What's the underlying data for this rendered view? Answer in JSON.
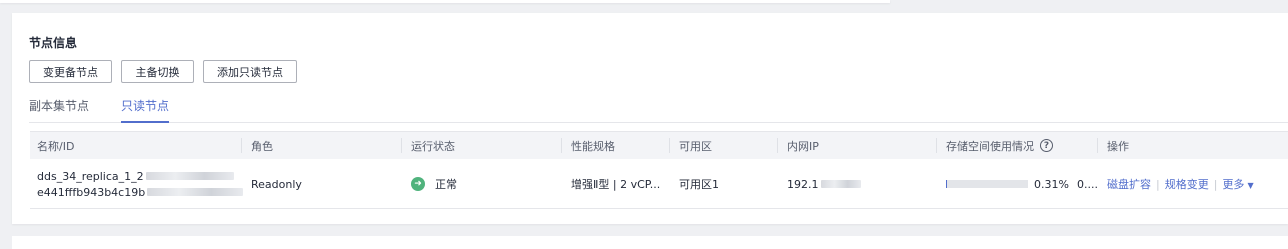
{
  "section": {
    "title": "节点信息"
  },
  "buttons": {
    "change_standby": "变更备节点",
    "switch_primary": "主备切换",
    "add_readonly": "添加只读节点"
  },
  "tabs": [
    {
      "label": "副本集节点",
      "active": false
    },
    {
      "label": "只读节点",
      "active": true
    }
  ],
  "table": {
    "headers": {
      "name": "名称/ID",
      "role": "角色",
      "status": "运行状态",
      "spec": "性能规格",
      "az": "可用区",
      "ip": "内网IP",
      "storage": "存储空间使用情况",
      "actions": "操作"
    },
    "rows": [
      {
        "name": "dds_34_replica_1_2",
        "id": "e441fffb943b4c19b",
        "role": "Readonly",
        "status": "正常",
        "spec": "增强Ⅱ型 | 2 vCP...",
        "az": "可用区1",
        "ip": "192.1",
        "storage_pct": "0.31%",
        "storage_pct_value": 0.31,
        "storage_more": "0....",
        "actions": {
          "expand": "磁盘扩容",
          "change_spec": "规格变更",
          "more": "更多"
        }
      }
    ]
  },
  "colors": {
    "accent": "#526ecc",
    "success": "#50b37d",
    "text": "#252b3a",
    "muted": "#575d6c"
  },
  "icons": {
    "help": "question-circle-icon",
    "status": "check-circle-icon",
    "more": "caret-down-icon"
  }
}
